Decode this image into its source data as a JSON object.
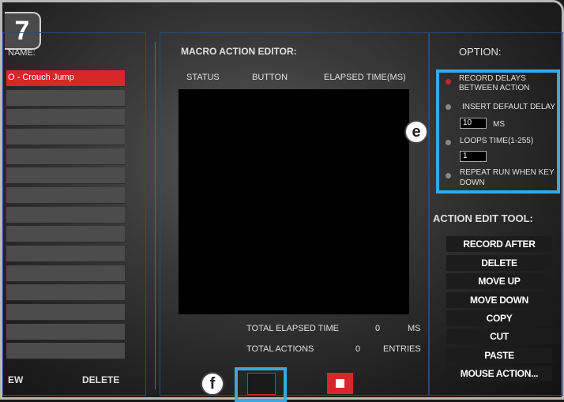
{
  "step_number": "7",
  "left_panel": {
    "name_label": "NAME:",
    "selected_macro": "O - Crouch Jump",
    "new_button": "EW",
    "delete_button": "DELETE"
  },
  "editor": {
    "title": "MACRO ACTION EDITOR:",
    "columns": [
      "STATUS",
      "BUTTON",
      "ELAPSED TIME(MS)"
    ],
    "total_elapsed_label": "TOTAL ELAPSED TIME",
    "total_elapsed_value": "0",
    "total_elapsed_unit": "MS",
    "total_actions_label": "TOTAL ACTIONS",
    "total_actions_value": "0",
    "total_actions_unit": "ENTRIES"
  },
  "options": {
    "title": "OPTION:",
    "record_delays_line1": "RECORD DELAYS",
    "record_delays_line2": "BETWEEN ACTION",
    "insert_default_delay": "INSERT DEFAULT DELAY",
    "delay_value": "10",
    "delay_unit": "MS",
    "loops_time": "LOOPS TIME(1-255)",
    "loops_value": "1",
    "repeat_run_line1": "REPEAT RUN WHEN KEY",
    "repeat_run_line2": "DOWN"
  },
  "tools": {
    "title": "ACTION EDIT TOOL:",
    "buttons": [
      "RECORD AFTER",
      "DELETE",
      "MOVE UP",
      "MOVE DOWN",
      "COPY",
      "CUT",
      "PASTE",
      "MOUSE ACTION..."
    ]
  },
  "callouts": {
    "e": "e",
    "f": "f"
  },
  "colors": {
    "accent_blue": "#3aa8e0",
    "record_red": "#d8262d"
  }
}
